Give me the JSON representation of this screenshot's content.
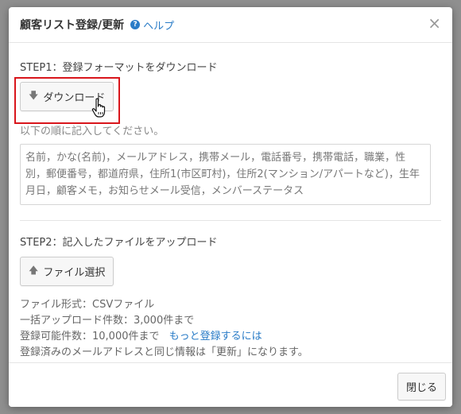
{
  "dialog": {
    "title": "顧客リスト登録/更新",
    "help_label": "ヘルプ",
    "close_symbol": "×"
  },
  "step1": {
    "title": "STEP1：登録フォーマットをダウンロード",
    "download_label": "ダウンロード",
    "hint": "以下の順に記入してください。",
    "fields": "名前，かな(名前)，メールアドレス，携帯メール，電話番号，携帯電話，職業，性別，郵便番号，都道府県，住所1(市区町村)，住所2(マンション/アパートなど)，生年月日，顧客メモ，お知らせメール受信，メンバーステータス"
  },
  "step2": {
    "title": "STEP2：記入したファイルをアップロード",
    "select_file_label": "ファイル選択",
    "format_line": "ファイル形式：CSVファイル",
    "bulk_limit_line": "一括アップロード件数：3,000件まで",
    "capacity_line": "登録可能件数：10,000件まで",
    "more_link": "もっと登録するには",
    "update_note": "登録済みのメールアドレスと同じ情報は「更新」になります。"
  },
  "footer": {
    "close_label": "閉じる"
  },
  "colors": {
    "accent": "#2a7cc7",
    "highlight": "#d9161c",
    "overlay": "#8f8f8f"
  },
  "icons": {
    "help": "question-circle-icon",
    "download": "arrow-down-icon",
    "upload": "arrow-up-icon",
    "close": "close-icon",
    "cursor": "hand-pointer-icon"
  }
}
